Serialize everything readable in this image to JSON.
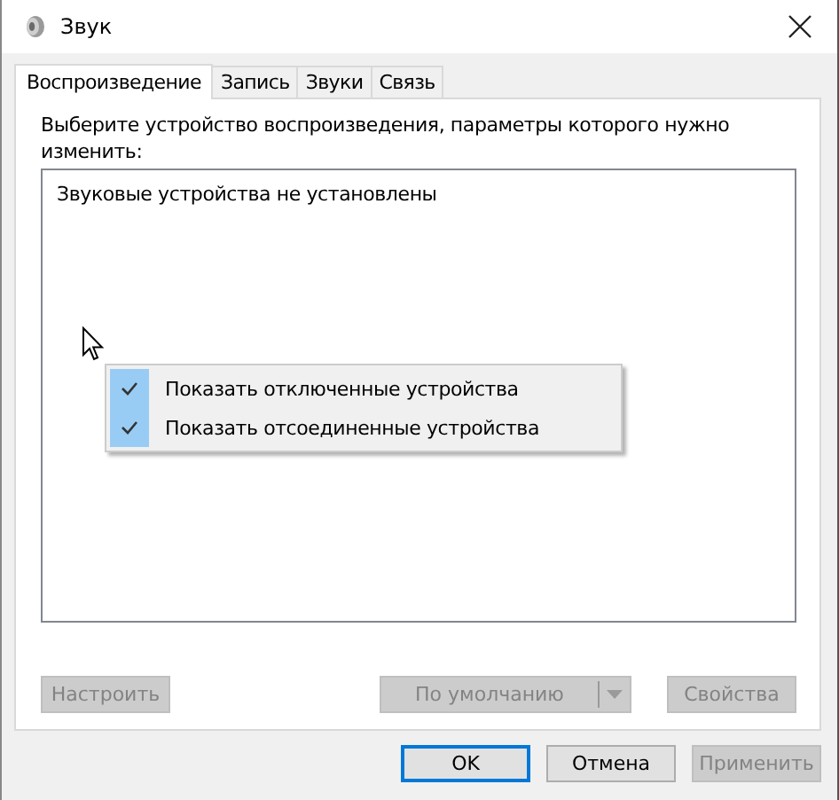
{
  "window": {
    "title": "Звук"
  },
  "tabs": [
    {
      "label": "Воспроизведение",
      "selected": true
    },
    {
      "label": "Запись",
      "selected": false
    },
    {
      "label": "Звуки",
      "selected": false
    },
    {
      "label": "Связь",
      "selected": false
    }
  ],
  "instruction": "Выберите устройство воспроизведения, параметры которого нужно изменить:",
  "device_list": {
    "empty_message": "Звуковые устройства не установлены"
  },
  "context_menu": [
    {
      "label": "Показать отключенные устройства",
      "checked": true
    },
    {
      "label": "Показать отсоединенные устройства",
      "checked": true
    }
  ],
  "panel_buttons": [
    {
      "kind": "button",
      "label": "Настроить",
      "disabled": true
    },
    {
      "kind": "split",
      "label": "По умолчанию",
      "disabled": true
    },
    {
      "kind": "button",
      "label": "Свойства",
      "disabled": true
    }
  ],
  "dialog_buttons": [
    {
      "label": "OK",
      "default": true,
      "disabled": false
    },
    {
      "label": "Отмена",
      "default": false,
      "disabled": false
    },
    {
      "label": "Применить",
      "default": false,
      "disabled": true
    }
  ]
}
